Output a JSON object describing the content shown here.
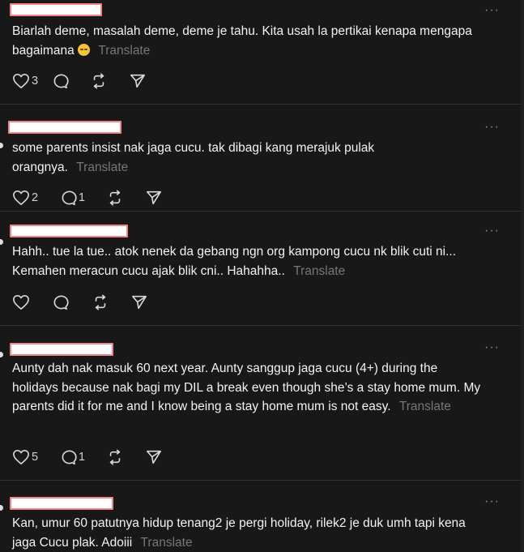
{
  "posts": [
    {
      "text": "Biarlah deme, masalah deme, deme je tahu. Kita usah la pertikai kenapa mengapa bagaimana",
      "has_emoji": true,
      "translate": "Translate",
      "likes": "3",
      "replies": "",
      "more": "···"
    },
    {
      "text": "some parents insist nak jaga cucu. tak dibagi kang merajuk pulak orangnya.",
      "translate": "Translate",
      "likes": "2",
      "replies": "1",
      "more": "···"
    },
    {
      "text": "Hahh.. tue la tue.. atok nenek da gebang ngn org kampong cucu nk blik cuti ni... Kemahen meracun cucu ajak blik cni.. Hahahha..",
      "translate": "Translate",
      "likes": "",
      "replies": "",
      "more": "···"
    },
    {
      "text": "Aunty dah nak masuk 60 next year. Aunty sanggup jaga cucu (4+) during the holidays because nak bagi my DIL a break even though she’s a stay home mum. My parents did it for me and I know being a stay home mum is not easy.",
      "translate": "Translate",
      "likes": "5",
      "replies": "1",
      "more": "···"
    },
    {
      "text": "Kan, umur 60 patutnya hidup tenang2 je pergi holiday, rilek2 je duk umh tapi kena jaga Cucu plak. Adoiii",
      "translate": "Translate",
      "likes": "",
      "replies": "",
      "more": "···"
    }
  ]
}
